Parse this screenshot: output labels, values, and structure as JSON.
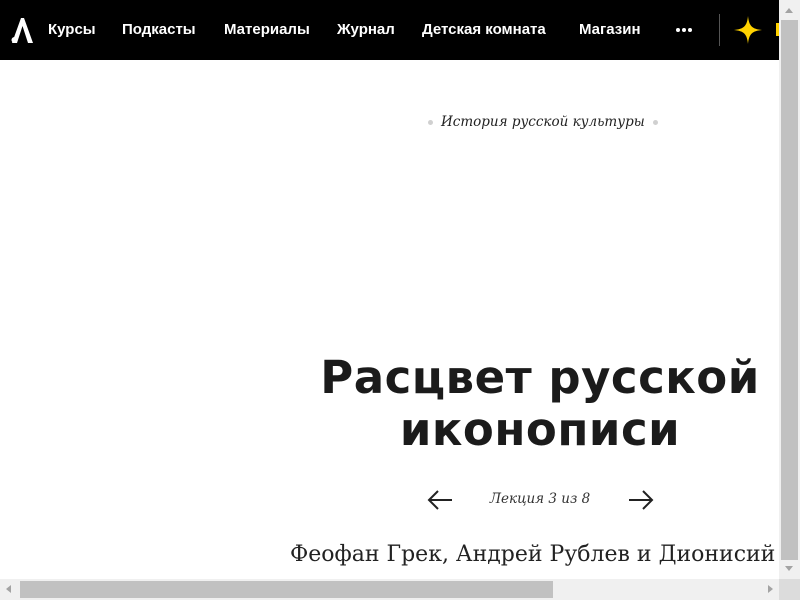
{
  "header": {
    "logo_text": "А",
    "nav": [
      {
        "label": "Курсы"
      },
      {
        "label": "Подкасты"
      },
      {
        "label": "Материалы"
      },
      {
        "label": "Журнал"
      },
      {
        "label": "Детская комната"
      },
      {
        "label": "Магазин"
      }
    ],
    "more_icon": "ellipsis-icon",
    "accent_icon": "sparkle-icon",
    "accent_color": "#ffd200"
  },
  "course": {
    "link_label": "История русской культуры"
  },
  "lecture": {
    "title_line1": "Расцвет русской",
    "title_line2": "иконописи",
    "counter": "Лекция 3 из 8",
    "prev_icon": "arrow-left-icon",
    "next_icon": "arrow-right-icon",
    "subtitle": "Феофан Грек, Андрей Рублев и Дионисий"
  },
  "colors": {
    "header_bg": "#000000",
    "text": "#1b1b1b",
    "muted_dot": "#d0d0d0"
  }
}
